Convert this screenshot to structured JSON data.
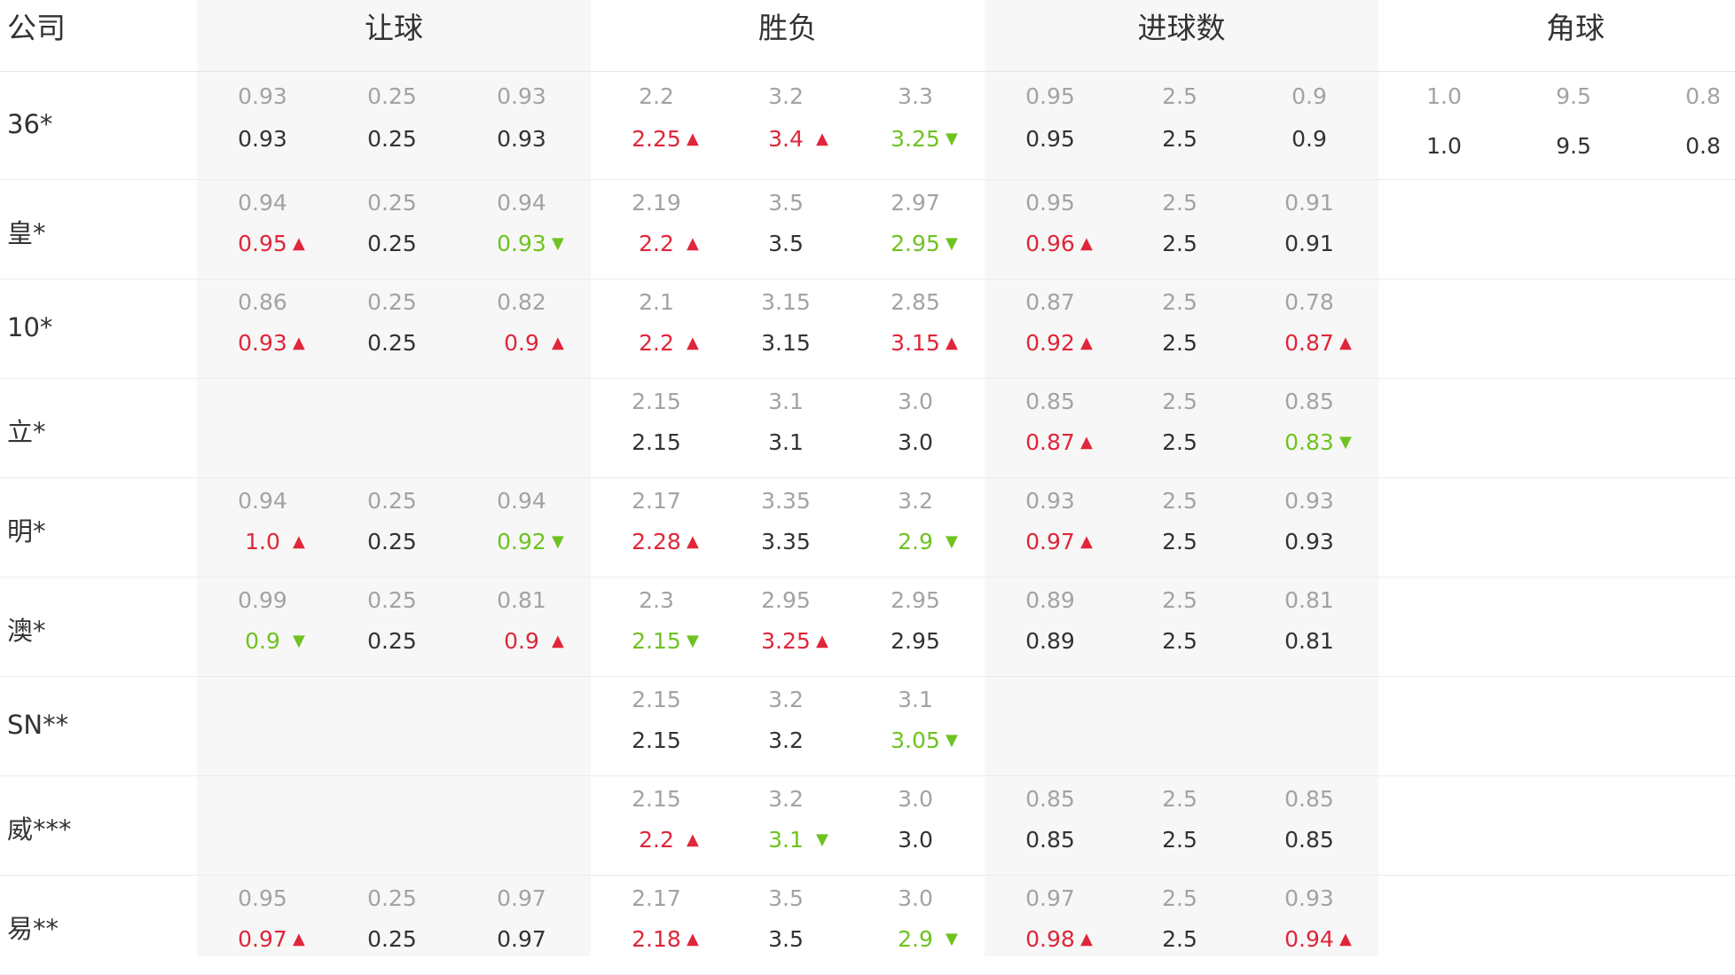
{
  "header": {
    "company": "公司",
    "groups": [
      "让球",
      "胜负",
      "进球数",
      "角球"
    ]
  },
  "rows": [
    {
      "name": "36*",
      "handicap": {
        "open": [
          "0.93",
          "0.25",
          "0.93"
        ],
        "cur": [
          [
            "0.93",
            ""
          ],
          [
            "0.25",
            ""
          ],
          [
            "0.93",
            ""
          ]
        ]
      },
      "winlose": {
        "open": [
          "2.2",
          "3.2",
          "3.3"
        ],
        "cur": [
          [
            "2.25",
            "up"
          ],
          [
            "3.4",
            "up"
          ],
          [
            "3.25",
            "down"
          ]
        ]
      },
      "goals": {
        "open": [
          "0.95",
          "2.5",
          "0.9"
        ],
        "cur": [
          [
            "0.95",
            ""
          ],
          [
            "2.5",
            ""
          ],
          [
            "0.9",
            ""
          ]
        ]
      },
      "corners": {
        "open": [
          "1.0",
          "9.5",
          "0.8"
        ],
        "cur": [
          [
            "1.0",
            ""
          ],
          [
            "9.5",
            ""
          ],
          [
            "0.8",
            ""
          ]
        ]
      }
    },
    {
      "name": "皇*",
      "handicap": {
        "open": [
          "0.94",
          "0.25",
          "0.94"
        ],
        "cur": [
          [
            "0.95",
            "up"
          ],
          [
            "0.25",
            ""
          ],
          [
            "0.93",
            "down"
          ]
        ]
      },
      "winlose": {
        "open": [
          "2.19",
          "3.5",
          "2.97"
        ],
        "cur": [
          [
            "2.2",
            "up"
          ],
          [
            "3.5",
            ""
          ],
          [
            "2.95",
            "down"
          ]
        ]
      },
      "goals": {
        "open": [
          "0.95",
          "2.5",
          "0.91"
        ],
        "cur": [
          [
            "0.96",
            "up"
          ],
          [
            "2.5",
            ""
          ],
          [
            "0.91",
            ""
          ]
        ]
      }
    },
    {
      "name": "10*",
      "handicap": {
        "open": [
          "0.86",
          "0.25",
          "0.82"
        ],
        "cur": [
          [
            "0.93",
            "up"
          ],
          [
            "0.25",
            ""
          ],
          [
            "0.9",
            "up"
          ]
        ]
      },
      "winlose": {
        "open": [
          "2.1",
          "3.15",
          "2.85"
        ],
        "cur": [
          [
            "2.2",
            "up"
          ],
          [
            "3.15",
            ""
          ],
          [
            "3.15",
            "up"
          ]
        ]
      },
      "goals": {
        "open": [
          "0.87",
          "2.5",
          "0.78"
        ],
        "cur": [
          [
            "0.92",
            "up"
          ],
          [
            "2.5",
            ""
          ],
          [
            "0.87",
            "up"
          ]
        ]
      }
    },
    {
      "name": "立*",
      "winlose": {
        "open": [
          "2.15",
          "3.1",
          "3.0"
        ],
        "cur": [
          [
            "2.15",
            ""
          ],
          [
            "3.1",
            ""
          ],
          [
            "3.0",
            ""
          ]
        ]
      },
      "goals": {
        "open": [
          "0.85",
          "2.5",
          "0.85"
        ],
        "cur": [
          [
            "0.87",
            "up"
          ],
          [
            "2.5",
            ""
          ],
          [
            "0.83",
            "down"
          ]
        ]
      }
    },
    {
      "name": "明*",
      "handicap": {
        "open": [
          "0.94",
          "0.25",
          "0.94"
        ],
        "cur": [
          [
            "1.0",
            "up"
          ],
          [
            "0.25",
            ""
          ],
          [
            "0.92",
            "down"
          ]
        ]
      },
      "winlose": {
        "open": [
          "2.17",
          "3.35",
          "3.2"
        ],
        "cur": [
          [
            "2.28",
            "up"
          ],
          [
            "3.35",
            ""
          ],
          [
            "2.9",
            "down"
          ]
        ]
      },
      "goals": {
        "open": [
          "0.93",
          "2.5",
          "0.93"
        ],
        "cur": [
          [
            "0.97",
            "up"
          ],
          [
            "2.5",
            ""
          ],
          [
            "0.93",
            ""
          ]
        ]
      }
    },
    {
      "name": "澳*",
      "handicap": {
        "open": [
          "0.99",
          "0.25",
          "0.81"
        ],
        "cur": [
          [
            "0.9",
            "down"
          ],
          [
            "0.25",
            ""
          ],
          [
            "0.9",
            "up"
          ]
        ]
      },
      "winlose": {
        "open": [
          "2.3",
          "2.95",
          "2.95"
        ],
        "cur": [
          [
            "2.15",
            "down"
          ],
          [
            "3.25",
            "up"
          ],
          [
            "2.95",
            ""
          ]
        ]
      },
      "goals": {
        "open": [
          "0.89",
          "2.5",
          "0.81"
        ],
        "cur": [
          [
            "0.89",
            ""
          ],
          [
            "2.5",
            ""
          ],
          [
            "0.81",
            ""
          ]
        ]
      }
    },
    {
      "name": "SN**",
      "winlose": {
        "open": [
          "2.15",
          "3.2",
          "3.1"
        ],
        "cur": [
          [
            "2.15",
            ""
          ],
          [
            "3.2",
            ""
          ],
          [
            "3.05",
            "down"
          ]
        ]
      }
    },
    {
      "name": "威***",
      "winlose": {
        "open": [
          "2.15",
          "3.2",
          "3.0"
        ],
        "cur": [
          [
            "2.2",
            "up"
          ],
          [
            "3.1",
            "down"
          ],
          [
            "3.0",
            ""
          ]
        ]
      },
      "goals": {
        "open": [
          "0.85",
          "2.5",
          "0.85"
        ],
        "cur": [
          [
            "0.85",
            ""
          ],
          [
            "2.5",
            ""
          ],
          [
            "0.85",
            ""
          ]
        ]
      }
    },
    {
      "name": "易**",
      "handicap": {
        "open": [
          "0.95",
          "0.25",
          "0.97"
        ],
        "cur": [
          [
            "0.97",
            "up"
          ],
          [
            "0.25",
            ""
          ],
          [
            "0.97",
            ""
          ]
        ]
      },
      "winlose": {
        "open": [
          "2.17",
          "3.5",
          "3.0"
        ],
        "cur": [
          [
            "2.18",
            "up"
          ],
          [
            "3.5",
            ""
          ],
          [
            "2.9",
            "down"
          ]
        ]
      },
      "goals": {
        "open": [
          "0.97",
          "2.5",
          "0.93"
        ],
        "cur": [
          [
            "0.98",
            "up"
          ],
          [
            "2.5",
            ""
          ],
          [
            "0.94",
            "up"
          ]
        ]
      }
    }
  ],
  "colors": {
    "up": "#e0263a",
    "down": "#6fc320",
    "open": "#a3a3a3",
    "current": "#333333"
  },
  "icons": {
    "up": "arrow-up-icon",
    "down": "arrow-down-icon"
  }
}
